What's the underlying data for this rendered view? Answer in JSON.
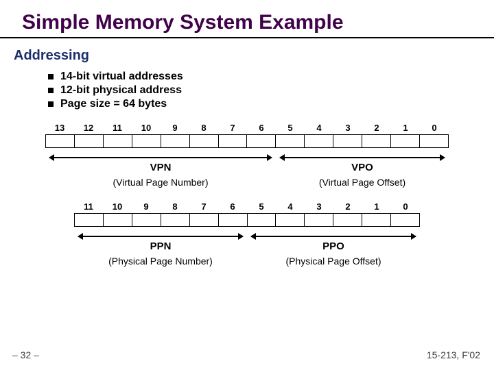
{
  "title": "Simple Memory System Example",
  "section": "Addressing",
  "bullets": [
    "14-bit virtual addresses",
    "12-bit physical address",
    "Page size = 64 bytes"
  ],
  "virtual": {
    "bits": [
      "13",
      "12",
      "11",
      "10",
      "9",
      "8",
      "7",
      "6",
      "5",
      "4",
      "3",
      "2",
      "1",
      "0"
    ],
    "seg1": {
      "abbr": "VPN",
      "full": "(Virtual Page Number)",
      "span": 8
    },
    "seg2": {
      "abbr": "VPO",
      "full": "(Virtual Page Offset)",
      "span": 6
    }
  },
  "physical": {
    "bits": [
      "11",
      "10",
      "9",
      "8",
      "7",
      "6",
      "5",
      "4",
      "3",
      "2",
      "1",
      "0"
    ],
    "seg1": {
      "abbr": "PPN",
      "full": "(Physical Page Number)",
      "span": 6
    },
    "seg2": {
      "abbr": "PPO",
      "full": "(Physical Page Offset)",
      "span": 6
    }
  },
  "footer": {
    "left": "– 32 –",
    "right": "15-213, F'02"
  }
}
